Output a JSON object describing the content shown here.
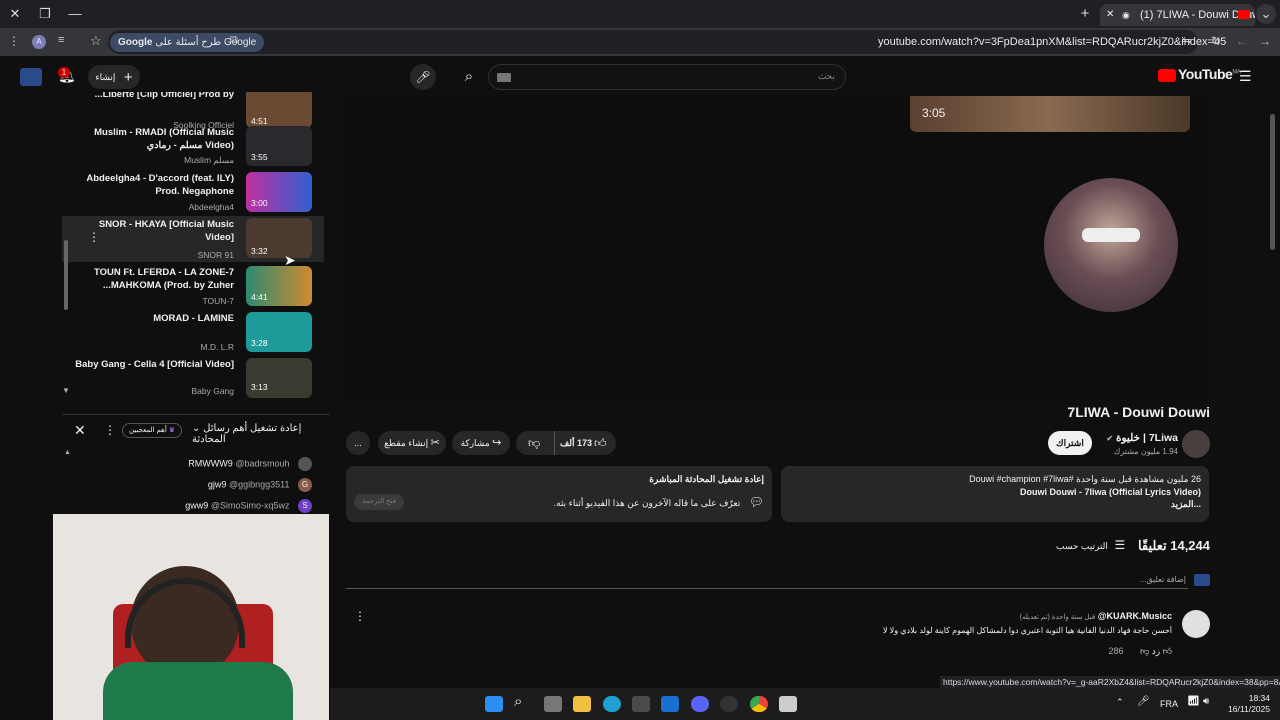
{
  "browser": {
    "tab_title": "(1) 7LIWA - Douwi Douwi",
    "google_chip": "طرح أسئلة على Google",
    "url": "youtube.com/watch?v=3FpDea1pnXM&list=RDQARucr2kjZ0&index=45",
    "status_url": "https://www.youtube.com/watch?v=_g-aaR2XbZ4&list=RDQARucr2kjZ0&index=38&pp=8AUB"
  },
  "header": {
    "logo_text": "YouTube",
    "logo_region": "MA",
    "search_placeholder": "بحث",
    "create_label": "إنشاء",
    "notification_count": "1"
  },
  "playlist": {
    "items": [
      {
        "title": "Liberté [Clip Officiel] Prod by...",
        "channel": "Soolking Officiel",
        "duration": "4:51",
        "thumb_color": "#6a4a32"
      },
      {
        "title": "Muslim - RMADI (Official Music Video) مسلم - رمادي",
        "channel": "Muslim مسلم",
        "duration": "3:55",
        "thumb_color": "#2a2a2e"
      },
      {
        "title": "Abdeelgha4 - D'accord (feat. ILY) Prod. Negaphone",
        "channel": "Abdeelgha4",
        "duration": "3:00",
        "thumb_color": "#7a2fbf"
      },
      {
        "title": "SNOR - HKAYA [Official Music Video]",
        "channel": "SNOR 91",
        "duration": "3:32",
        "thumb_color": "#4a3a30"
      },
      {
        "title": "TOUN Ft. LFERDA - LA ZONE-7 MAHKOMA (Prod. by Zuher...",
        "channel": "TOUN-7",
        "duration": "4:41",
        "thumb_color": "#2e6a58"
      },
      {
        "title": "MORAD - LAMINE",
        "channel": "M.D. L.R",
        "duration": "3:28",
        "thumb_color": "#1e9a9a"
      },
      {
        "title": "Baby Gang - Cella 4 [Official Video]",
        "channel": "Baby Gang",
        "duration": "3:13",
        "thumb_color": "#3a3a30"
      }
    ]
  },
  "chat": {
    "header_title": "إعادة تشغيل أهم رسائل المحادثة",
    "badge": "أهم المعجبين",
    "messages": [
      {
        "text": "RMWWW9",
        "user": "@badrsmouh",
        "initial": "",
        "color": "#555"
      },
      {
        "text": "gjw9",
        "user": "@ggibngg3511",
        "initial": "G",
        "color": "#8a5a4a"
      },
      {
        "text": "gww9",
        "user": "@SimoSimo-xq5wz",
        "initial": "S",
        "color": "#6a3fc9"
      }
    ]
  },
  "video": {
    "endcard_duration": "3:05",
    "title": "7LIWA - Douwi Douwi",
    "channel_name": "7Liwa | خليوة",
    "subscribers": "1.94 مليون مشترك",
    "subscribe_label": "اشتراك",
    "likes": "173 ألف",
    "share_label": "مشاركة",
    "clip_label": "إنشاء مقطع",
    "more_label": "..."
  },
  "description": {
    "stats": "26 مليون مشاهدة  قبل سنة واحدة  #Douwi #champion #7liwa",
    "line1": "Douwi Douwi - 7liwa (Official Lyrics Video)",
    "more": "...المزيد"
  },
  "live_chat_panel": {
    "title": "إعادة تشغيل المحادثة المباشرة",
    "text": "تعرّف على ما قاله الآخرون عن هذا الفيديو أثناء بثه.",
    "button": "فتح الترجمة"
  },
  "comments": {
    "count": "14,244 تعليقًا",
    "sort_label": "الترتيب حسب",
    "add_placeholder": "إضافة تعليق...",
    "first": {
      "author": "@KUARK.Musicc",
      "time": "قبل سنة واحدة (تم تعديله)",
      "text": "أحسن حاجة فهاد الدنيا الفانية هيا التوبة اعتبري دوا دلمشاكل الهموم كاينة لولد بلادي ولا لا",
      "likes": "286",
      "reply": "رد"
    }
  },
  "taskbar": {
    "lang": "FRA",
    "time": "18:34",
    "date": "16/11/2025"
  }
}
